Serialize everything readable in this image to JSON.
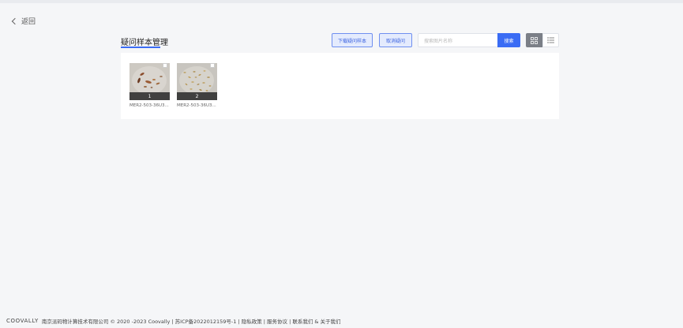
{
  "nav": {
    "back_label": "返回"
  },
  "page": {
    "title": "疑问样本管理"
  },
  "toolbar": {
    "download_label": "下载疑问样本",
    "cancel_label": "取消疑问",
    "search_placeholder": "搜索图片名称",
    "search_button": "搜索"
  },
  "samples": [
    {
      "index": "1",
      "name": "MER2-503-36U3..."
    },
    {
      "index": "2",
      "name": "MER2-503-36U3..."
    }
  ],
  "footer": {
    "logo": "COOVALLY",
    "text": "南京派码物计算技术有限公司 © 2020 -2023 Coovally | 苏ICP备2022012159号-1 | 隐私政策 | 服务协议 | 联系我们 & 关于我们"
  },
  "colors": {
    "accent": "#3a6cf4",
    "page_bg": "#f5f6f8"
  }
}
